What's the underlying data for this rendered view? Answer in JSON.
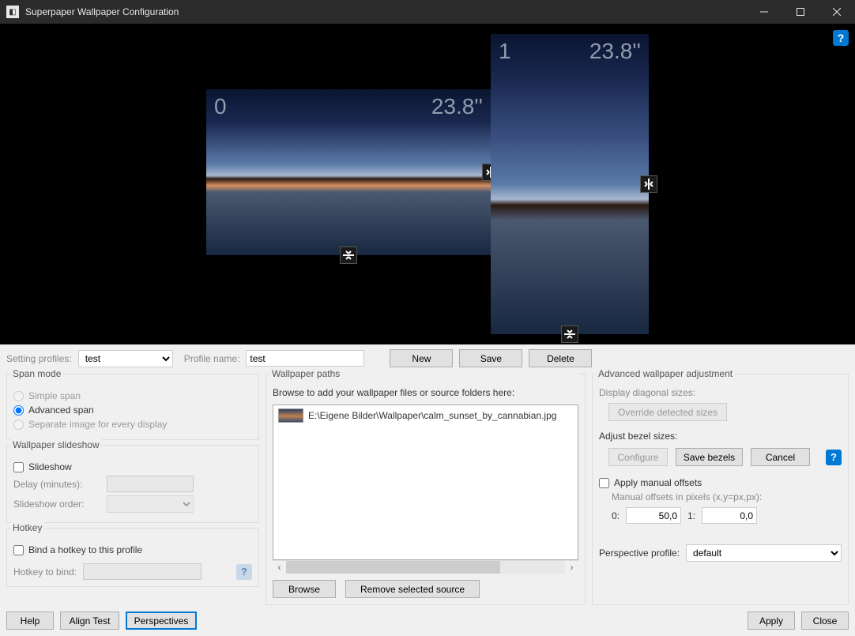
{
  "window": {
    "title": "Superpaper Wallpaper Configuration"
  },
  "preview": {
    "monitors": [
      {
        "id": "0",
        "size": "23.8''"
      },
      {
        "id": "1",
        "size": "23.8''"
      }
    ]
  },
  "toprow": {
    "setting_profiles_label": "Setting profiles:",
    "setting_profiles_value": "test",
    "profile_name_label": "Profile name:",
    "profile_name_value": "test",
    "new_btn": "New",
    "save_btn": "Save",
    "delete_btn": "Delete"
  },
  "span_mode": {
    "title": "Span mode",
    "simple": "Simple span",
    "advanced": "Advanced span",
    "separate": "Separate image for every display"
  },
  "slideshow": {
    "title": "Wallpaper slideshow",
    "checkbox": "Slideshow",
    "delay_label": "Delay (minutes):",
    "order_label": "Slideshow order:"
  },
  "hotkey": {
    "title": "Hotkey",
    "checkbox": "Bind a hotkey to this profile",
    "bind_label": "Hotkey to bind:"
  },
  "paths": {
    "title": "Wallpaper paths",
    "instruction": "Browse to add your wallpaper files or source folders here:",
    "items": [
      "E:\\Eigene Bilder\\Wallpaper\\calm_sunset_by_cannabian.jpg"
    ],
    "browse_btn": "Browse",
    "remove_btn": "Remove selected source"
  },
  "advanced": {
    "title": "Advanced wallpaper adjustment",
    "display_diag_label": "Display diagonal sizes:",
    "override_btn": "Override detected sizes",
    "adjust_bezel_label": "Adjust bezel sizes:",
    "configure_btn": "Configure",
    "save_bezels_btn": "Save bezels",
    "cancel_btn": "Cancel",
    "manual_offsets_check": "Apply manual offsets",
    "manual_offsets_hint": "Manual offsets in pixels (x,y=px,px):",
    "offset0_label": "0:",
    "offset0_value": "50,0",
    "offset1_label": "1:",
    "offset1_value": "0,0",
    "perspective_label": "Perspective profile:",
    "perspective_value": "default"
  },
  "bottom": {
    "help_btn": "Help",
    "align_btn": "Align Test",
    "persp_btn": "Perspectives",
    "apply_btn": "Apply",
    "close_btn": "Close"
  }
}
